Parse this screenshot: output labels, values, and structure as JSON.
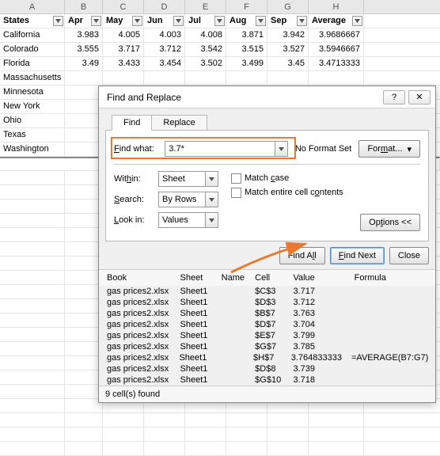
{
  "grid": {
    "col_letters": [
      "A",
      "B",
      "C",
      "D",
      "E",
      "F",
      "G",
      "H"
    ],
    "headers": [
      "States",
      "Apr",
      "May",
      "Jun",
      "Jul",
      "Aug",
      "Sep",
      "Average"
    ],
    "rows": [
      [
        "California",
        "3.983",
        "4.005",
        "4.003",
        "4.008",
        "3.871",
        "3.942",
        "3.9686667"
      ],
      [
        "Colorado",
        "3.555",
        "3.717",
        "3.712",
        "3.542",
        "3.515",
        "3.527",
        "3.5946667"
      ],
      [
        "Florida",
        "3.49",
        "3.433",
        "3.454",
        "3.502",
        "3.499",
        "3.45",
        "3.4713333"
      ],
      [
        "Massachusetts",
        "",
        "",
        "",
        "",
        "",
        "",
        ""
      ],
      [
        "Minnesota",
        "",
        "",
        "",
        "",
        "",
        "",
        ""
      ],
      [
        "New York",
        "",
        "",
        "",
        "",
        "",
        "",
        ""
      ],
      [
        "Ohio",
        "",
        "",
        "",
        "",
        "",
        "",
        ""
      ],
      [
        "Texas",
        "",
        "",
        "",
        "",
        "",
        "",
        ""
      ],
      [
        "Washington",
        "",
        "",
        "",
        "",
        "",
        "",
        ""
      ]
    ]
  },
  "dialog": {
    "title": "Find and Replace",
    "tabs": {
      "find": "Find",
      "replace": "Replace"
    },
    "find_what_label": "Find what:",
    "find_what_value": "3.7*",
    "no_format": "No Format Set",
    "format_btn": "Format...",
    "within_label": "Within:",
    "within_value": "Sheet",
    "search_label": "Search:",
    "search_value": "By Rows",
    "lookin_label": "Look in:",
    "lookin_value": "Values",
    "match_case": "Match case",
    "match_entire": "Match entire cell contents",
    "options_btn": "Options <<",
    "find_all": "Find All",
    "find_next": "Find Next",
    "close": "Close",
    "results_headers": {
      "book": "Book",
      "sheet": "Sheet",
      "name": "Name",
      "cell": "Cell",
      "value": "Value",
      "formula": "Formula"
    },
    "results": [
      {
        "book": "gas prices2.xlsx",
        "sheet": "Sheet1",
        "name": "",
        "cell": "$C$3",
        "value": "3.717",
        "formula": ""
      },
      {
        "book": "gas prices2.xlsx",
        "sheet": "Sheet1",
        "name": "",
        "cell": "$D$3",
        "value": "3.712",
        "formula": ""
      },
      {
        "book": "gas prices2.xlsx",
        "sheet": "Sheet1",
        "name": "",
        "cell": "$B$7",
        "value": "3.763",
        "formula": ""
      },
      {
        "book": "gas prices2.xlsx",
        "sheet": "Sheet1",
        "name": "",
        "cell": "$D$7",
        "value": "3.704",
        "formula": ""
      },
      {
        "book": "gas prices2.xlsx",
        "sheet": "Sheet1",
        "name": "",
        "cell": "$E$7",
        "value": "3.799",
        "formula": ""
      },
      {
        "book": "gas prices2.xlsx",
        "sheet": "Sheet1",
        "name": "",
        "cell": "$G$7",
        "value": "3.785",
        "formula": ""
      },
      {
        "book": "gas prices2.xlsx",
        "sheet": "Sheet1",
        "name": "",
        "cell": "$H$7",
        "value": "3.764833333",
        "formula": "=AVERAGE(B7:G7)"
      },
      {
        "book": "gas prices2.xlsx",
        "sheet": "Sheet1",
        "name": "",
        "cell": "$D$8",
        "value": "3.739",
        "formula": ""
      },
      {
        "book": "gas prices2.xlsx",
        "sheet": "Sheet1",
        "name": "",
        "cell": "$G$10",
        "value": "3.718",
        "formula": ""
      }
    ],
    "status": "9 cell(s) found"
  }
}
